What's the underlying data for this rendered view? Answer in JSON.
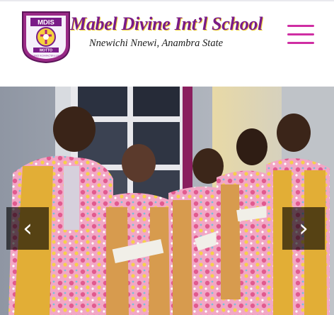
{
  "header": {
    "logo": {
      "top_text": "MDIS",
      "ring_text": "MABEL DIVINE INT'L SCHOOL",
      "motto_label": "MOTTO",
      "motto": "EXCELLENCE IN CHARACTER & LEARNING"
    },
    "school_name": "Mabel Divine Int’l School",
    "location": "Nnewichi Nnewi, Anambra State",
    "menu_icon": "hamburger-menu-icon"
  },
  "hero": {
    "prev_label": "‹",
    "next_label": "›",
    "prev_icon": "chevron-left-icon",
    "next_icon": "chevron-right-icon"
  },
  "colors": {
    "brand_purple": "#7a1b88",
    "brand_yellow": "#f1d43c",
    "menu_pink": "#cf2ea3",
    "uniform_pink": "#f2a7c5",
    "uniform_tan": "#d79b4e"
  }
}
